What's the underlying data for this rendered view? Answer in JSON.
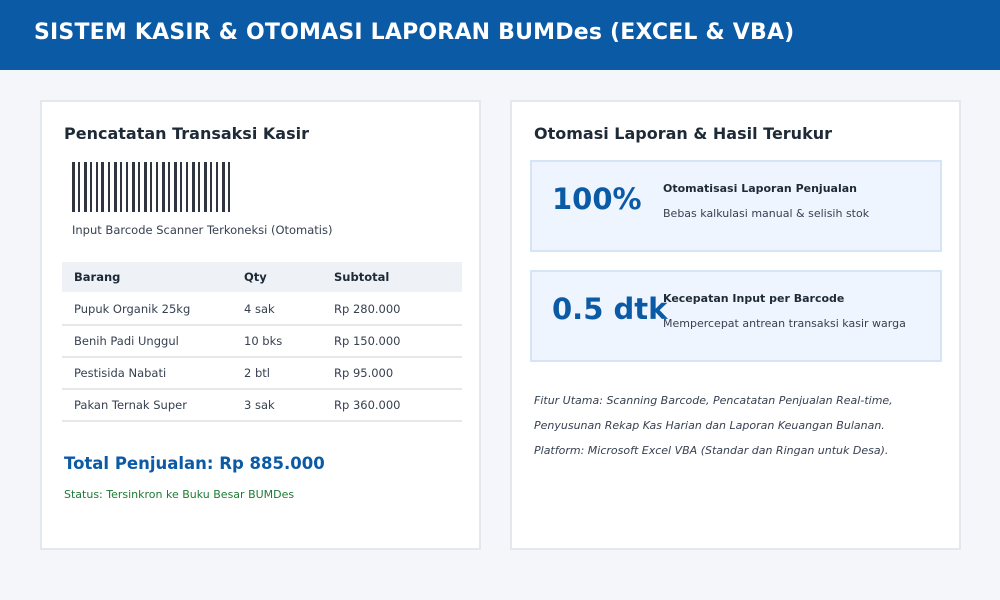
{
  "header": {
    "title": "SISTEM KASIR & OTOMASI LAPORAN BUMDes (EXCEL & VBA)"
  },
  "left_card": {
    "title": "Pencatatan Transaksi Kasir",
    "barcode_caption": "Input Barcode Scanner Terkoneksi (Otomatis)",
    "table": {
      "headers": [
        "Barang",
        "Qty",
        "Subtotal"
      ],
      "rows": [
        [
          "Pupuk Organik 25kg",
          "4 sak",
          "Rp 280.000"
        ],
        [
          "Benih Padi Unggul",
          "10 bks",
          "Rp 150.000"
        ],
        [
          "Pestisida Nabati",
          "2 btl",
          "Rp 95.000"
        ],
        [
          "Pakan Ternak Super",
          "3 sak",
          "Rp 360.000"
        ]
      ]
    },
    "total": "Total Penjualan: Rp 885.000",
    "status": "Status: Tersinkron ke Buku Besar BUMDes"
  },
  "right_card": {
    "title": "Otomasi Laporan & Hasil Terukur",
    "metrics": [
      {
        "value": "100%",
        "title": "Otomatisasi Laporan Penjualan",
        "desc": "Bebas kalkulasi manual & selisih stok"
      },
      {
        "value": "0.5 dtk",
        "title": "Kecepatan Input per Barcode",
        "desc": "Mempercepat antrean transaksi kasir warga"
      }
    ],
    "notes": [
      "Fitur Utama: Scanning Barcode, Pencatatan Penjualan Real-time,",
      "Penyusunan Rekap Kas Harian dan Laporan Keuangan Bulanan.",
      "Platform: Microsoft Excel VBA (Standar dan Ringan untuk Desa)."
    ]
  },
  "colors": {
    "header_bg": "#0b5aa6",
    "accent": "#0b5aa6",
    "status_green": "#1e7b34",
    "metric_bg": "#eef5ff"
  },
  "icons": [
    "barcode-icon"
  ]
}
